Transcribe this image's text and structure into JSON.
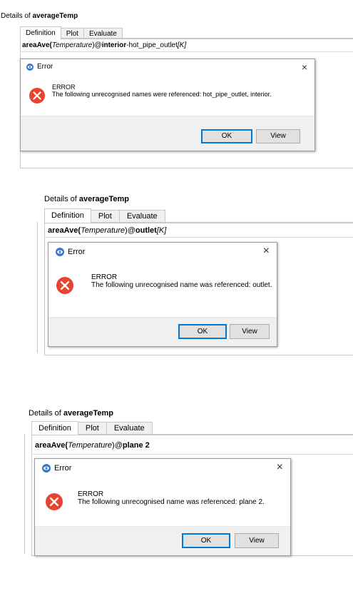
{
  "panels": [
    {
      "header_prefix": "Details of ",
      "header_name": "averageTemp",
      "tabs": [
        "Definition",
        "Plot",
        "Evaluate"
      ],
      "expr_fn": "areaAve(",
      "expr_arg": "Temperature",
      "expr_close": ")@",
      "expr_loc": "interior",
      "expr_tail": "-hot_pipe_outlet",
      "expr_unit": "[K]",
      "dialog_title": "Error",
      "close_glyph": "×",
      "msg_title": "ERROR",
      "msg_body": "The following unrecognised names were referenced: hot_pipe_outlet, interior.",
      "ok_label": "OK",
      "view_label": "View"
    },
    {
      "header_prefix": "Details of ",
      "header_name": "averageTemp",
      "tabs": [
        "Definition",
        "Plot",
        "Evaluate"
      ],
      "expr_fn": "areaAve(",
      "expr_arg": "Temperature",
      "expr_close": ")@",
      "expr_loc": "outlet",
      "expr_tail": "",
      "expr_unit": "[K]",
      "dialog_title": "Error",
      "close_glyph": "×",
      "msg_title": "ERROR",
      "msg_body": "The following unrecognised name was referenced: outlet.",
      "ok_label": "OK",
      "view_label": "View"
    },
    {
      "header_prefix": "Details of ",
      "header_name": "averageTemp",
      "tabs": [
        "Definition",
        "Plot",
        "Evaluate"
      ],
      "expr_fn": "areaAve(",
      "expr_arg": "Temperature",
      "expr_close": ")@",
      "expr_loc": "plane 2",
      "expr_tail": "",
      "expr_unit": "",
      "dialog_title": "Error",
      "close_glyph": "×",
      "msg_title": "ERROR",
      "msg_body": "The following unrecognised name was referenced: plane 2.",
      "ok_label": "OK",
      "view_label": "View"
    }
  ],
  "colors": {
    "error_red": "#e8432e",
    "app_icon_blue": "#3a78c8",
    "ok_border": "#0078d7"
  }
}
